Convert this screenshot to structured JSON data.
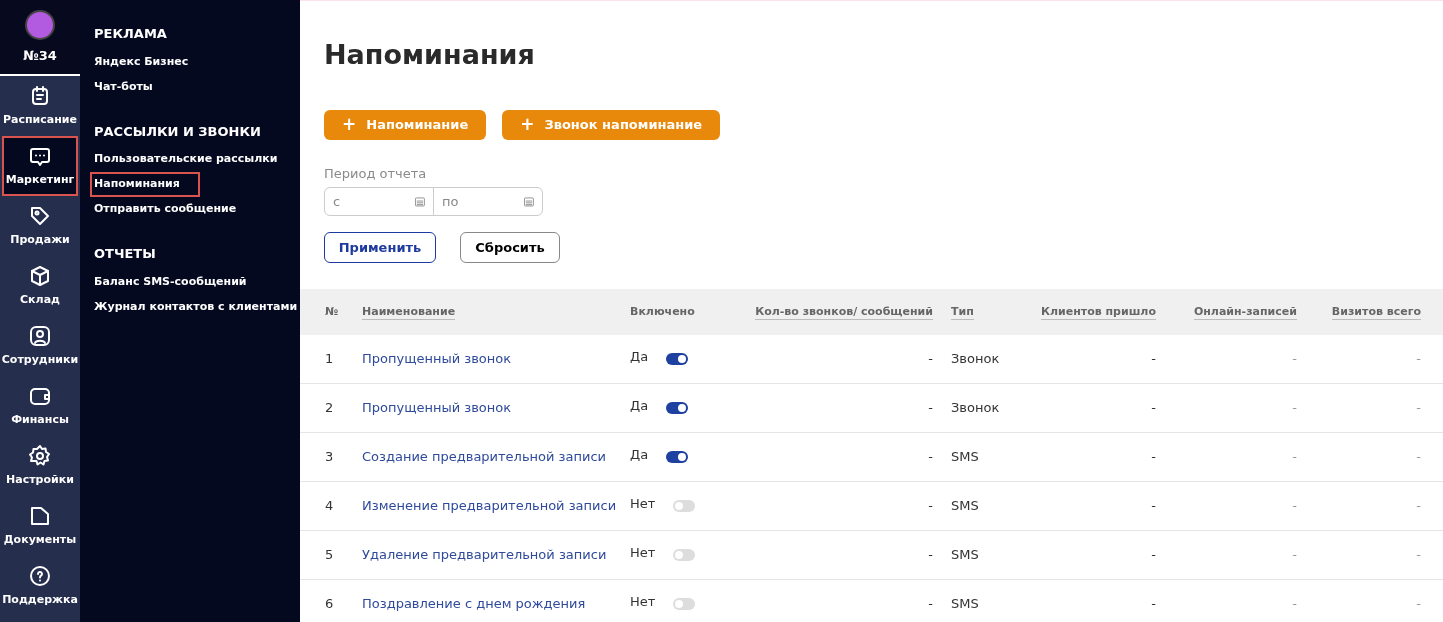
{
  "rail": {
    "badge": "№34",
    "items": [
      {
        "kind": "calendar",
        "label": "Расписание",
        "selected": false
      },
      {
        "kind": "chat",
        "label": "Маркетинг",
        "selected": true
      },
      {
        "kind": "tag",
        "label": "Продажи",
        "selected": false
      },
      {
        "kind": "box",
        "label": "Склад",
        "selected": false
      },
      {
        "kind": "person",
        "label": "Сотрудники",
        "selected": false
      },
      {
        "kind": "wallet",
        "label": "Финансы",
        "selected": false
      },
      {
        "kind": "gear",
        "label": "Настройки",
        "selected": false
      },
      {
        "kind": "folder",
        "label": "Документы",
        "selected": false
      },
      {
        "kind": "help",
        "label": "Поддержка",
        "selected": false
      }
    ]
  },
  "submenu": [
    {
      "heading": "РЕКЛАМА",
      "items": [
        {
          "label": "Яндекс Бизнес",
          "selected": false
        },
        {
          "label": "Чат-боты",
          "selected": false
        }
      ]
    },
    {
      "heading": "РАССЫЛКИ И ЗВОНКИ",
      "items": [
        {
          "label": "Пользовательские рассылки",
          "selected": false
        },
        {
          "label": "Напоминания",
          "selected": true
        },
        {
          "label": "Отправить сообщение",
          "selected": false
        }
      ]
    },
    {
      "heading": "ОТЧЕТЫ",
      "items": [
        {
          "label": "Баланс SMS-сообщений",
          "selected": false
        },
        {
          "label": "Журнал контактов с клиентами",
          "selected": false
        }
      ]
    }
  ],
  "title": "Напоминания",
  "actions": [
    {
      "icon": "+",
      "label": "Напоминание"
    },
    {
      "icon": "+",
      "label": "Звонок напоминание"
    }
  ],
  "period": {
    "label": "Период отчета",
    "from": {
      "placeholder": "с"
    },
    "to": {
      "placeholder": "по"
    }
  },
  "filter_buttons": [
    {
      "kind": "primary",
      "label": "Применить"
    },
    {
      "kind": "secondary",
      "label": "Сбросить"
    }
  ],
  "table": {
    "columns": [
      "№",
      "Наименование",
      "Включено",
      "Кол-во звонков/ сообщений",
      "Тип",
      "Клиентов пришло",
      "Онлайн-записей",
      "Визитов всего"
    ],
    "rows": [
      {
        "number": "1",
        "name": "Пропущенный звонок",
        "enabled_label": "Да",
        "on": true,
        "count": "-",
        "type": "Звонок",
        "clients": "-",
        "online": "-",
        "visits": "-"
      },
      {
        "number": "2",
        "name": "Пропущенный звонок",
        "enabled_label": "Да",
        "on": true,
        "count": "-",
        "type": "Звонок",
        "clients": "-",
        "online": "-",
        "visits": "-"
      },
      {
        "number": "3",
        "name": "Создание предварительной записи",
        "enabled_label": "Да",
        "on": true,
        "count": "-",
        "type": "SMS",
        "clients": "-",
        "online": "-",
        "visits": "-"
      },
      {
        "number": "4",
        "name": "Изменение предварительной записи",
        "enabled_label": "Нет",
        "on": false,
        "count": "-",
        "type": "SMS",
        "clients": "-",
        "online": "-",
        "visits": "-"
      },
      {
        "number": "5",
        "name": "Удаление предварительной записи",
        "enabled_label": "Нет",
        "on": false,
        "count": "-",
        "type": "SMS",
        "clients": "-",
        "online": "-",
        "visits": "-"
      },
      {
        "number": "6",
        "name": "Поздравление с днем рождения",
        "enabled_label": "Нет",
        "on": false,
        "count": "-",
        "type": "SMS",
        "clients": "-",
        "online": "-",
        "visits": "-"
      }
    ]
  }
}
